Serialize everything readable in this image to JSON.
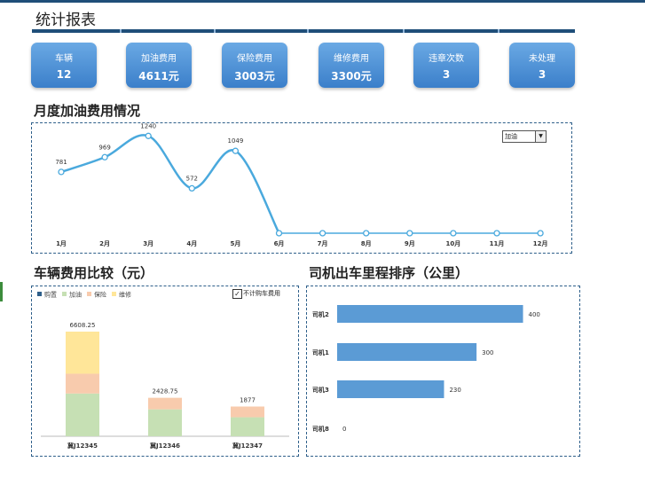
{
  "title": "统计报表",
  "cards": [
    {
      "label": "车辆",
      "value": "12"
    },
    {
      "label": "加油费用",
      "value": "4611元"
    },
    {
      "label": "保险费用",
      "value": "3003元"
    },
    {
      "label": "维修费用",
      "value": "3300元"
    },
    {
      "label": "违章次数",
      "value": "3"
    },
    {
      "label": "未处理",
      "value": "3"
    }
  ],
  "fuel_section": {
    "title": "月度加油费用情况",
    "dropdown_value": "加油"
  },
  "vehicle_section": {
    "title": "车辆费用比较（元）",
    "checkbox_label": "不计购车费用",
    "checkbox_checked": true
  },
  "driver_section": {
    "title": "司机出车里程排序（公里）"
  },
  "colors": {
    "line": "#4aa9dd",
    "bar": "#5b9bd5",
    "purchase": "#2e5f8a",
    "fuel": "#c6e0b4",
    "insurance": "#f8cbad",
    "repair": "#ffe699"
  },
  "chart_data": [
    {
      "type": "line",
      "categories": [
        "1月",
        "2月",
        "3月",
        "4月",
        "5月",
        "6月",
        "7月",
        "8月",
        "9月",
        "10月",
        "11月",
        "12月"
      ],
      "values": [
        781,
        969,
        1240,
        572,
        1049,
        0,
        0,
        0,
        0,
        0,
        0,
        0
      ],
      "labels": [
        "781",
        "969",
        "1240",
        "572",
        "1049",
        "",
        "",
        "",
        "",
        "",
        "",
        ""
      ],
      "ylim": [
        0,
        1300
      ]
    },
    {
      "type": "bar",
      "stacked": true,
      "categories": [
        "冀J12345",
        "冀J12346",
        "冀J12347"
      ],
      "totals": [
        "6608.25",
        "2428.75",
        "1877"
      ],
      "series": [
        {
          "name": "购置",
          "values": [
            0,
            0,
            0
          ]
        },
        {
          "name": "加油",
          "values": [
            2700,
            1700,
            1200
          ]
        },
        {
          "name": "保险",
          "values": [
            1250,
            729,
            677
          ]
        },
        {
          "name": "维修",
          "values": [
            2658.25,
            0,
            0
          ]
        }
      ],
      "ylim": [
        0,
        7000
      ],
      "legend": "top-left"
    },
    {
      "type": "bar",
      "orientation": "horizontal",
      "categories": [
        "司机2",
        "司机1",
        "司机3",
        "司机8"
      ],
      "values": [
        400,
        300,
        230,
        0
      ],
      "xlim": [
        0,
        420
      ]
    }
  ]
}
